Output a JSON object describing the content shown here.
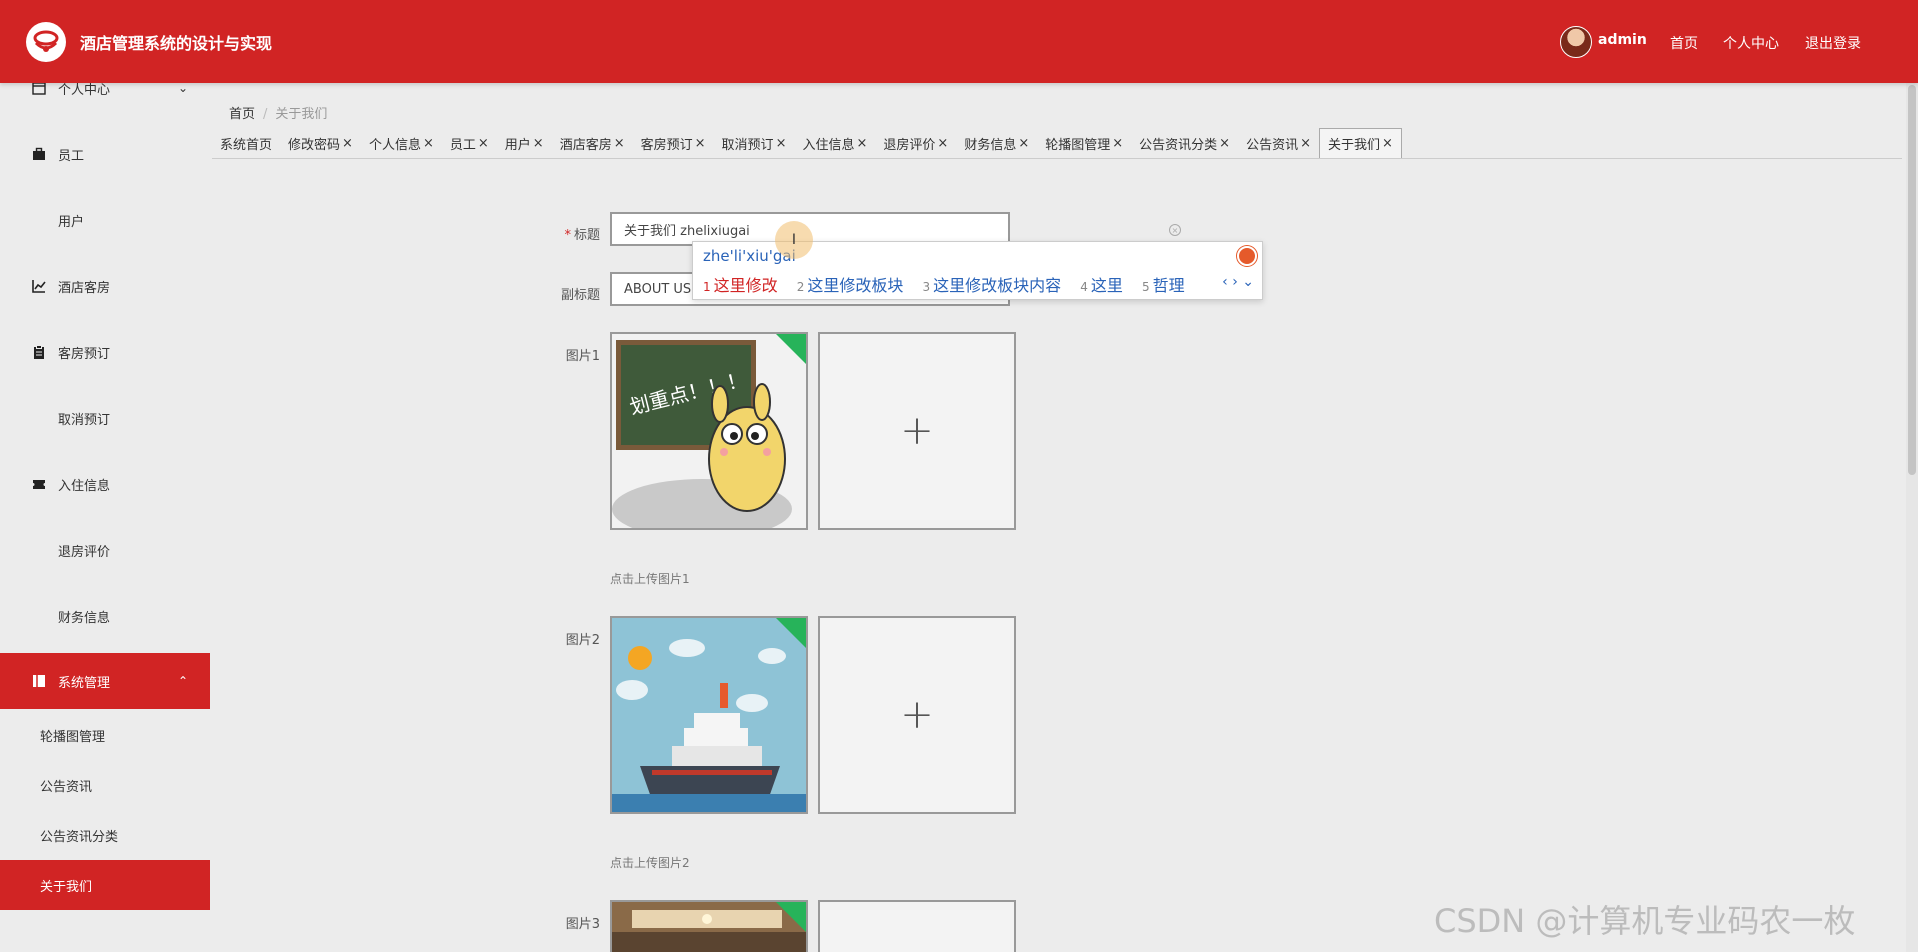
{
  "header": {
    "title": "酒店管理系统的设计与实现",
    "username": "admin",
    "links": [
      "首页",
      "个人中心",
      "退出登录"
    ]
  },
  "sidebar": {
    "items": [
      {
        "label": "个人中心",
        "icon": "calendar-icon"
      },
      {
        "label": "员工",
        "icon": "briefcase-icon"
      },
      {
        "label": "用户",
        "icon": "grid-icon"
      },
      {
        "label": "酒店客房",
        "icon": "chart-icon"
      },
      {
        "label": "客房预订",
        "icon": "clipboard-icon"
      },
      {
        "label": "取消预订",
        "icon": "grid-icon"
      },
      {
        "label": "入住信息",
        "icon": "ticket-icon"
      },
      {
        "label": "退房评价",
        "icon": "grid-icon"
      },
      {
        "label": "财务信息",
        "icon": "grid-icon"
      },
      {
        "label": "系统管理",
        "icon": "book-icon"
      }
    ],
    "sub_items": [
      "轮播图管理",
      "公告资讯",
      "公告资讯分类",
      "关于我们"
    ]
  },
  "breadcrumb": {
    "home": "首页",
    "current": "关于我们"
  },
  "tabs": [
    {
      "label": "系统首页",
      "closable": false
    },
    {
      "label": "修改密码",
      "closable": true
    },
    {
      "label": "个人信息",
      "closable": true
    },
    {
      "label": "员工",
      "closable": true
    },
    {
      "label": "用户",
      "closable": true
    },
    {
      "label": "酒店客房",
      "closable": true
    },
    {
      "label": "客房预订",
      "closable": true
    },
    {
      "label": "取消预订",
      "closable": true
    },
    {
      "label": "入住信息",
      "closable": true
    },
    {
      "label": "退房评价",
      "closable": true
    },
    {
      "label": "财务信息",
      "closable": true
    },
    {
      "label": "轮播图管理",
      "closable": true
    },
    {
      "label": "公告资讯分类",
      "closable": true
    },
    {
      "label": "公告资讯",
      "closable": true
    },
    {
      "label": "关于我们",
      "closable": true
    }
  ],
  "form": {
    "title_label": "标题",
    "title_value": "关于我们  zhelixiugai",
    "subtitle_label": "副标题",
    "subtitle_value": "ABOUT US",
    "images": [
      {
        "label": "图片1",
        "hint": "点击上传图片1"
      },
      {
        "label": "图片2",
        "hint": "点击上传图片2"
      },
      {
        "label": "图片3"
      }
    ]
  },
  "ime": {
    "pinyin": "zhe'li'xiu'gai",
    "candidates": [
      {
        "num": "1",
        "text": "这里修改"
      },
      {
        "num": "2",
        "text": "这里修改板块"
      },
      {
        "num": "3",
        "text": "这里修改板块内容"
      },
      {
        "num": "4",
        "text": "这里"
      },
      {
        "num": "5",
        "text": "哲理"
      }
    ],
    "nav": "‹ › ⌄"
  },
  "watermark": "CSDN @计算机专业码农一枚",
  "colors": {
    "brand": "#d12424",
    "badge": "#27b35a"
  }
}
